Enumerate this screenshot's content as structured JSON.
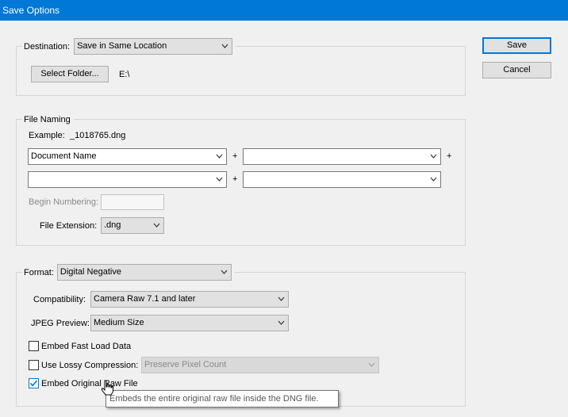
{
  "window": {
    "title": "Save Options"
  },
  "buttons": {
    "save": "Save",
    "cancel": "Cancel"
  },
  "destination": {
    "label": "Destination:",
    "value": "Save in Same Location",
    "select_folder": "Select Folder...",
    "path": "E:\\"
  },
  "file_naming": {
    "legend": "File Naming",
    "example_label": "Example:",
    "example_value": "_1018765.dng",
    "field1": "Document Name",
    "field2": "",
    "field3": "",
    "field4": "",
    "plus": "+",
    "begin_numbering_label": "Begin Numbering:",
    "begin_numbering_value": "",
    "extension_label": "File Extension:",
    "extension_value": ".dng"
  },
  "format": {
    "label": "Format:",
    "value": "Digital Negative",
    "compatibility_label": "Compatibility:",
    "compatibility_value": "Camera Raw 7.1 and later",
    "jpeg_preview_label": "JPEG Preview:",
    "jpeg_preview_value": "Medium Size",
    "embed_fast_load": {
      "label": "Embed Fast Load Data",
      "checked": false
    },
    "lossy": {
      "label": "Use Lossy Compression:",
      "checked": false,
      "value": "Preserve Pixel Count"
    },
    "embed_original": {
      "label": "Embed Original Raw File",
      "checked": true
    }
  },
  "tooltip": "Embeds the entire original raw file inside the DNG file.",
  "colors": {
    "accent": "#0078d7",
    "dialog_bg": "#f0f0f0"
  }
}
